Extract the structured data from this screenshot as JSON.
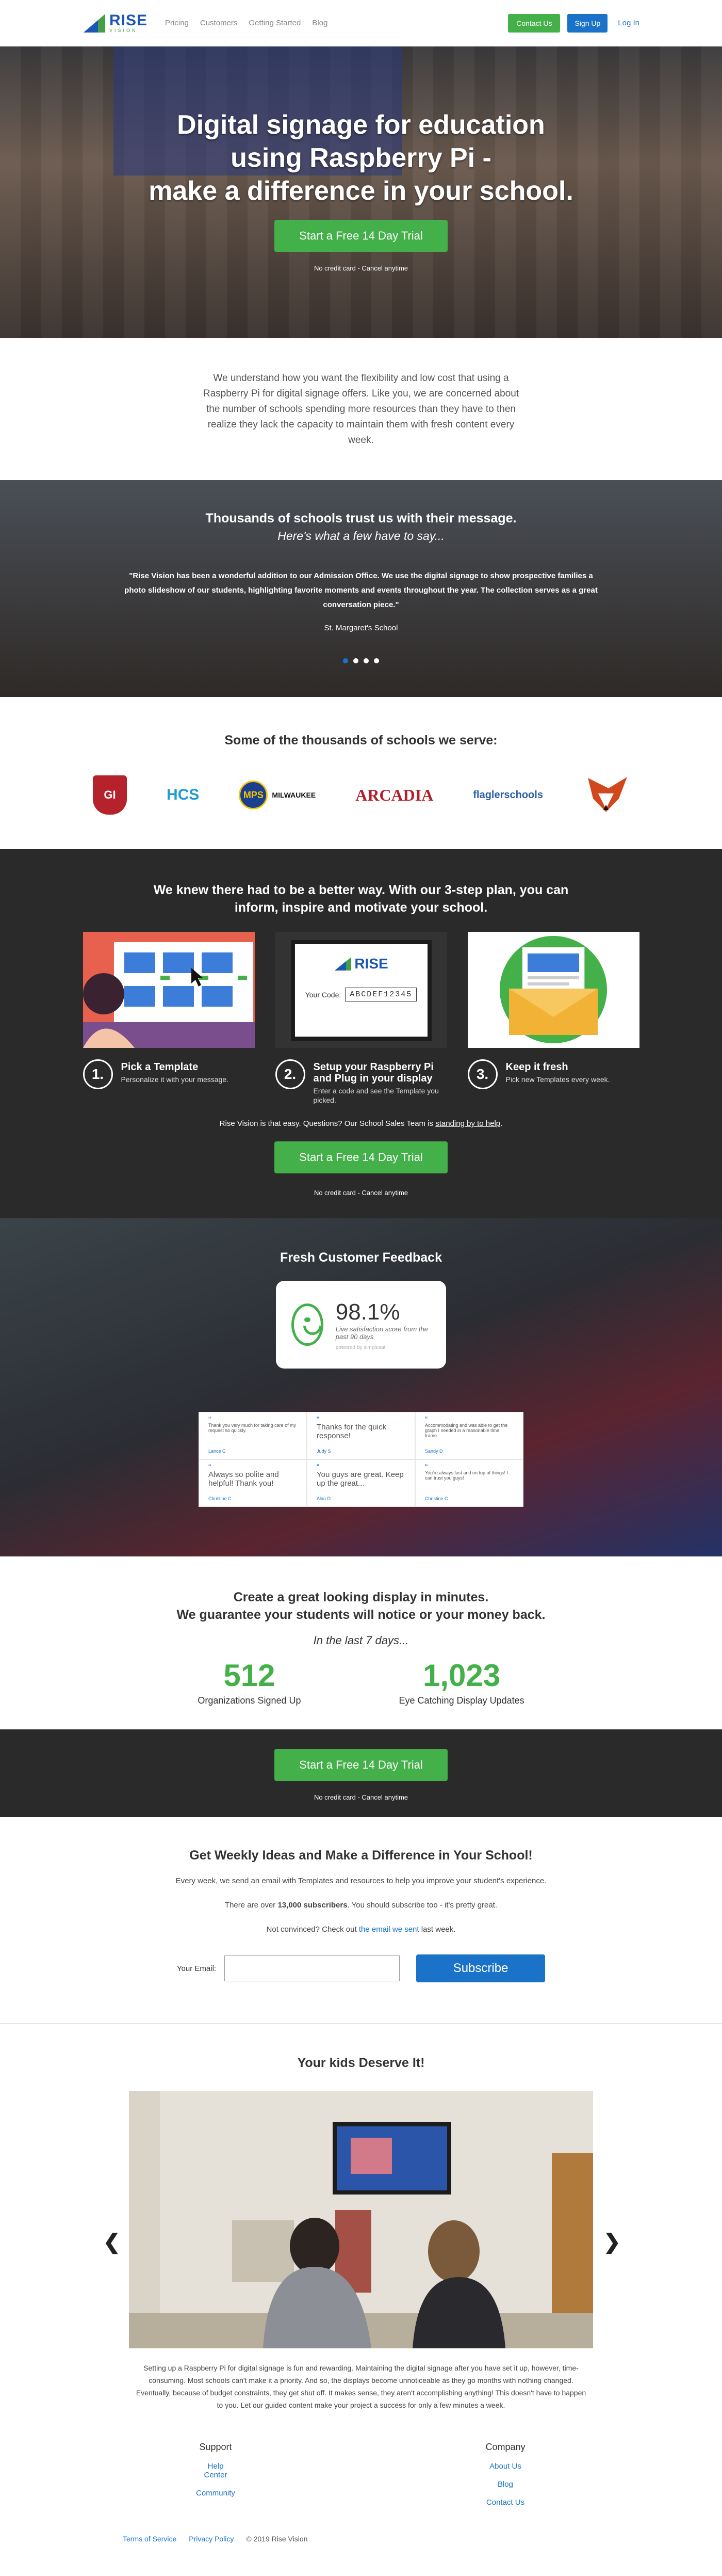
{
  "nav": {
    "links": [
      "Pricing",
      "Customers",
      "Getting Started",
      "Blog"
    ],
    "contact": "Contact Us",
    "signup": "Sign Up",
    "login": "Log In",
    "logo_text": "RISE",
    "logo_sub": "VISION"
  },
  "hero": {
    "title_1": "Digital signage for education",
    "title_2": "using Raspberry Pi -",
    "title_3": "make a difference in your school.",
    "cta": "Start a Free 14 Day Trial",
    "note": "No credit card - Cancel anytime"
  },
  "intro": "We understand how you want the flexibility and low cost that using a Raspberry Pi for digital signage offers. Like you, we are concerned about the number of schools spending more resources than they have to then realize they lack the capacity to maintain them with fresh content every week.",
  "trust": {
    "title": "Thousands of schools trust us with their message.",
    "subtitle": "Here's what a few have to say...",
    "quote": "\"Rise Vision has been a wonderful addition to our Admission Office. We use the digital signage to show prospective families a photo slideshow of our students, highlighting favorite moments and events throughout the year. The collection serves as a great conversation piece.\"",
    "who": "St. Margaret's School"
  },
  "schools": {
    "title": "Some of the thousands of schools we serve:",
    "logos": [
      "GI",
      "HCS",
      "MPS",
      "MILWAUKEE",
      "ARCADIA",
      "flaglerschools"
    ]
  },
  "plan": {
    "title": "We knew there had to be a better way. With our 3-step plan, you can inform, inspire and motivate your school.",
    "steps": [
      {
        "num": "1.",
        "title": "Pick a Template",
        "desc": "Personalize it with your message."
      },
      {
        "num": "2.",
        "title": "Setup your Raspberry Pi and Plug in your display",
        "desc": "Enter a code and see the Template you picked."
      },
      {
        "num": "3.",
        "title": "Keep it fresh",
        "desc": "Pick new Templates every week."
      }
    ],
    "code_label": "Your Code:",
    "code_value": "ABCDEF12345",
    "easy_pre": "Rise Vision is that easy. Questions? Our School Sales Team is ",
    "easy_link": "standing by to help",
    "cta": "Start a Free 14 Day Trial",
    "note": "No credit card - Cancel anytime"
  },
  "feedback": {
    "title": "Fresh Customer Feedback",
    "score": "98.1%",
    "score_sub": "Live satisfaction score from the past 90 days",
    "powered": "powered by simplesat",
    "cells": [
      {
        "text": "Thank you very much for taking care of my request so quickly.",
        "name": "Lance C",
        "small": true
      },
      {
        "text": "Thanks for the quick response!",
        "name": "Judy S",
        "small": false
      },
      {
        "text": "Accommodating and was able to get the graph I needed in a reasonable time frame.",
        "name": "Sandy D",
        "small": true
      },
      {
        "text": "Always so polite and helpful! Thank you!",
        "name": "Christine C",
        "small": false
      },
      {
        "text": "You guys are great. Keep up the great...",
        "name": "Alan D",
        "small": false
      },
      {
        "text": "You're always fast and on top of things! I can trust you guys!",
        "name": "Christine C",
        "small": true
      }
    ]
  },
  "stats": {
    "line1": "Create a great looking display in minutes.",
    "line2": "We guarantee your students will notice or your money back.",
    "period": "In the last 7 days...",
    "a_value": "512",
    "a_label": "Organizations Signed Up",
    "b_value": "1,023",
    "b_label": "Eye Catching Display Updates"
  },
  "ctaband": {
    "cta": "Start a Free 14 Day Trial",
    "note": "No credit card - Cancel anytime"
  },
  "subscribe": {
    "title": "Get Weekly Ideas and Make a Difference in Your School!",
    "p1": "Every week, we send an email with Templates and resources to help you improve your student's experience.",
    "p2_pre": "There are over ",
    "p2_bold": "13,000 subscribers",
    "p2_post": ". You should subscribe too - it's pretty great.",
    "p3_pre": "Not convinced? Check out ",
    "p3_link": "the email we sent",
    "p3_post": " last week.",
    "email_label": "Your Email:",
    "button": "Subscribe"
  },
  "kids": {
    "title": "Your kids Deserve It!",
    "desc": "Setting up a Raspberry Pi for digital signage is fun and rewarding. Maintaining the digital signage after you have set it up, however, time-consuming. Most schools can't make it a priority. And so, the displays become unnoticeable as they go months with nothing changed. Eventually, because of budget constraints, they get shut off. It makes sense, they aren't accomplishing anything! This doesn't have to happen to you. Let our guided content make your project a success for only a few minutes a week."
  },
  "footer": {
    "support_title": "Support",
    "support_links": [
      "Help Center",
      "Community"
    ],
    "company_title": "Company",
    "company_links": [
      "About Us",
      "Blog",
      "Contact Us"
    ],
    "terms": "Terms of Service",
    "privacy": "Privacy Policy",
    "copyright": "© 2019 Rise Vision"
  },
  "colors": {
    "green": "#43b049",
    "blue": "#1a73c8",
    "dark": "#2a2a2a"
  }
}
